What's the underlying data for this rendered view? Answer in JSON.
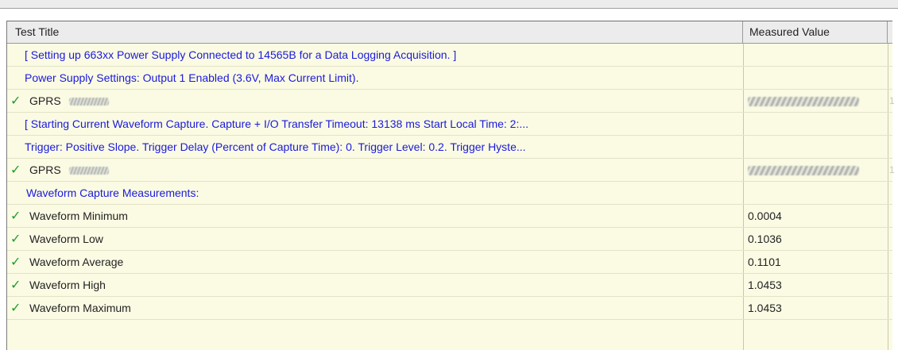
{
  "table": {
    "columns": {
      "title": "Test Title",
      "value": "Measured Value"
    },
    "rows": [
      {
        "type": "info",
        "title": "[ Setting up 663xx Power Supply Connected to 14565B for a Data Logging Acquisition. ]",
        "value": ""
      },
      {
        "type": "info",
        "title": "Power Supply Settings: Output 1 Enabled (3.6V, Max Current Limit).",
        "value": ""
      },
      {
        "type": "pass",
        "title": "GPRS",
        "value": "",
        "redacted": true,
        "extra": "1"
      },
      {
        "type": "info",
        "title": "[ Starting Current Waveform Capture.  Capture + I/O Transfer Timeout: 13138 ms  Start Local Time: 2:...",
        "value": ""
      },
      {
        "type": "info",
        "title": "Trigger: Positive Slope.  Trigger Delay (Percent of Capture Time): 0.  Trigger Level: 0.2.  Trigger Hyste...",
        "value": ""
      },
      {
        "type": "pass",
        "title": "GPRS",
        "value": "",
        "redacted": true,
        "extra": "1"
      },
      {
        "type": "info",
        "title": "Waveform Capture Measurements:",
        "value": ""
      },
      {
        "type": "pass",
        "title": "Waveform Minimum",
        "value": "0.0004"
      },
      {
        "type": "pass",
        "title": "Waveform Low",
        "value": "0.1036"
      },
      {
        "type": "pass",
        "title": "Waveform Average",
        "value": "0.1101"
      },
      {
        "type": "pass",
        "title": "Waveform High",
        "value": "1.0453"
      },
      {
        "type": "pass",
        "title": "Waveform Maximum",
        "value": "1.0453"
      }
    ]
  },
  "icons": {
    "pass": "checkmark-icon"
  },
  "colors": {
    "info_text": "#1a1adc",
    "row_bg": "#fbfbe4",
    "check": "#1f9e2a"
  }
}
